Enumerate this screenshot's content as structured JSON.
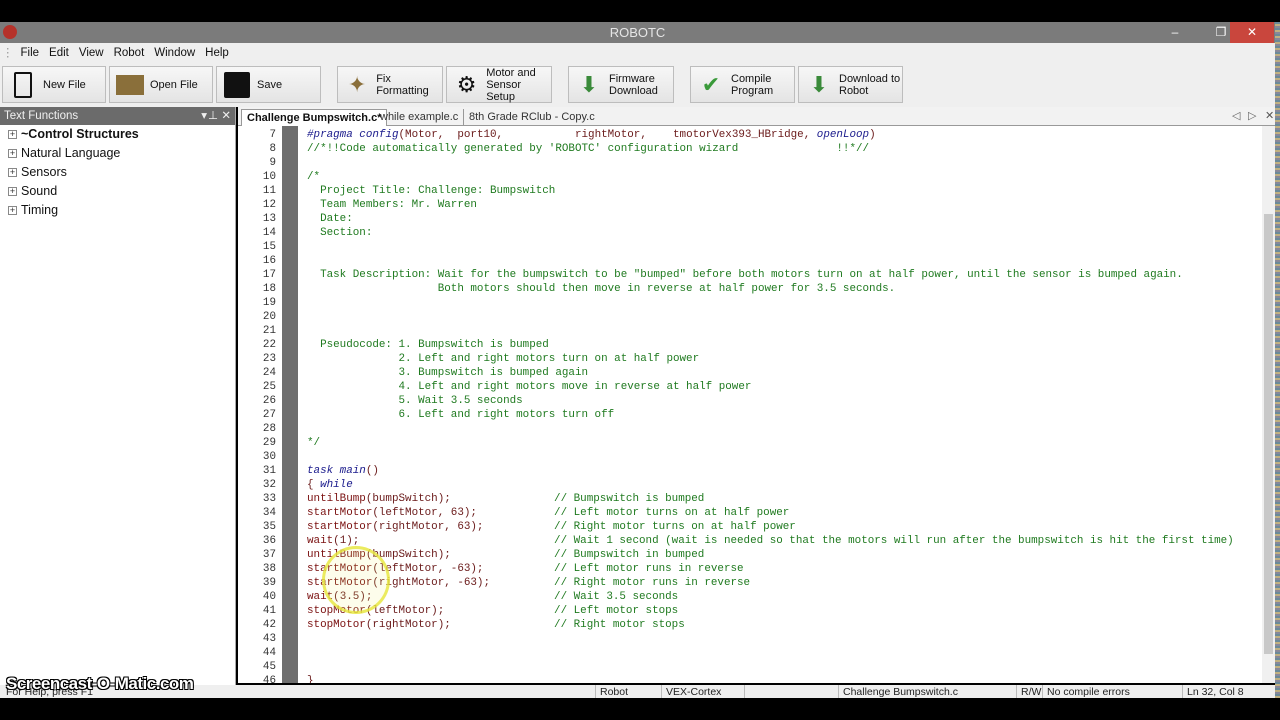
{
  "window": {
    "title": "ROBOTC",
    "minimize": "–",
    "restore": "❐",
    "close": "✕"
  },
  "menu": [
    "File",
    "Edit",
    "View",
    "Robot",
    "Window",
    "Help"
  ],
  "toolbar": {
    "new_file": "New File",
    "open_file": "Open File",
    "save": "Save",
    "fix_formatting": "Fix Formatting",
    "motor_setup_1": "Motor and",
    "motor_setup_2": "Sensor Setup",
    "firmware_1": "Firmware",
    "firmware_2": "Download",
    "compile_1": "Compile",
    "compile_2": "Program",
    "download_1": "Download to",
    "download_2": "Robot"
  },
  "left_panel": {
    "title": "Text Functions",
    "items": [
      "~Control Structures",
      "Natural Language",
      "Sensors",
      "Sound",
      "Timing"
    ]
  },
  "tabs": [
    "Challenge Bumpswitch.c*",
    "while example.c",
    "8th Grade RClub - Copy.c"
  ],
  "code": [
    {
      "n": "7",
      "t": [
        [
          "kw",
          "#pragma "
        ],
        [
          "kw",
          "config"
        ],
        [
          "pl",
          "(Motor,  port10,           rightMotor,    tmotorVex393_HBridge, "
        ],
        [
          "kw",
          "openLoop"
        ],
        [
          "pl",
          ")"
        ]
      ]
    },
    {
      "n": "8",
      "t": [
        [
          "cm",
          "//*!!Code automatically generated by 'ROBOTC' configuration wizard               !!*//"
        ]
      ]
    },
    {
      "n": "9",
      "t": []
    },
    {
      "n": "10",
      "t": [
        [
          "cm",
          "/*"
        ]
      ]
    },
    {
      "n": "11",
      "t": [
        [
          "cm",
          "  Project Title: Challenge: Bumpswitch"
        ]
      ]
    },
    {
      "n": "12",
      "t": [
        [
          "cm",
          "  Team Members: Mr. Warren"
        ]
      ]
    },
    {
      "n": "13",
      "t": [
        [
          "cm",
          "  Date:"
        ]
      ]
    },
    {
      "n": "14",
      "t": [
        [
          "cm",
          "  Section:"
        ]
      ]
    },
    {
      "n": "15",
      "t": []
    },
    {
      "n": "16",
      "t": []
    },
    {
      "n": "17",
      "t": [
        [
          "cm",
          "  Task Description: Wait for the bumpswitch to be \"bumped\" before both motors turn on at half power, until the sensor is bumped again."
        ]
      ]
    },
    {
      "n": "18",
      "t": [
        [
          "cm",
          "                    Both motors should then move in reverse at half power for 3.5 seconds."
        ]
      ]
    },
    {
      "n": "19",
      "t": []
    },
    {
      "n": "20",
      "t": []
    },
    {
      "n": "21",
      "t": []
    },
    {
      "n": "22",
      "t": [
        [
          "cm",
          "  Pseudocode: 1. Bumpswitch is bumped"
        ]
      ]
    },
    {
      "n": "23",
      "t": [
        [
          "cm",
          "              2. Left and right motors turn on at half power"
        ]
      ]
    },
    {
      "n": "24",
      "t": [
        [
          "cm",
          "              3. Bumpswitch is bumped again"
        ]
      ]
    },
    {
      "n": "25",
      "t": [
        [
          "cm",
          "              4. Left and right motors move in reverse at half power"
        ]
      ]
    },
    {
      "n": "26",
      "t": [
        [
          "cm",
          "              5. Wait 3.5 seconds"
        ]
      ]
    },
    {
      "n": "27",
      "t": [
        [
          "cm",
          "              6. Left and right motors turn off"
        ]
      ]
    },
    {
      "n": "28",
      "t": []
    },
    {
      "n": "29",
      "t": [
        [
          "cm",
          "*/"
        ]
      ]
    },
    {
      "n": "30",
      "t": []
    },
    {
      "n": "31",
      "t": [
        [
          "kw",
          "task main"
        ],
        [
          "pl",
          "()"
        ]
      ]
    },
    {
      "n": "32",
      "t": [
        [
          "pl",
          "{ "
        ],
        [
          "kw",
          "while"
        ]
      ]
    },
    {
      "n": "33",
      "t": [
        [
          "fn",
          "untilBump"
        ],
        [
          "pl",
          "(bumpSwitch);"
        ]
      ],
      "c": "// Bumpswitch is bumped"
    },
    {
      "n": "34",
      "t": [
        [
          "fn",
          "startMotor"
        ],
        [
          "pl",
          "(leftMotor, 63);"
        ]
      ],
      "c": "// Left motor turns on at half power"
    },
    {
      "n": "35",
      "t": [
        [
          "fn",
          "startMotor"
        ],
        [
          "pl",
          "(rightMotor, 63);"
        ]
      ],
      "c": "// Right motor turns on at half power"
    },
    {
      "n": "36",
      "t": [
        [
          "fn",
          "wait"
        ],
        [
          "pl",
          "(1);"
        ]
      ],
      "c": "// Wait 1 second (wait is needed so that the motors will run after the bumpswitch is hit the first time)"
    },
    {
      "n": "37",
      "t": [
        [
          "fn",
          "untilBump"
        ],
        [
          "pl",
          "(bumpSwitch);"
        ]
      ],
      "c": "// Bumpswitch in bumped"
    },
    {
      "n": "38",
      "t": [
        [
          "fn",
          "startMotor"
        ],
        [
          "pl",
          "(leftMotor, -63);"
        ]
      ],
      "c": "// Left motor runs in reverse"
    },
    {
      "n": "39",
      "t": [
        [
          "fn",
          "startMotor"
        ],
        [
          "pl",
          "(rightMotor, -63);"
        ]
      ],
      "c": "// Right motor runs in reverse"
    },
    {
      "n": "40",
      "t": [
        [
          "fn",
          "wait"
        ],
        [
          "pl",
          "(3.5);"
        ]
      ],
      "c": "// Wait 3.5 seconds"
    },
    {
      "n": "41",
      "t": [
        [
          "fn",
          "stopMotor"
        ],
        [
          "pl",
          "(leftMotor);"
        ]
      ],
      "c": "// Left motor stops"
    },
    {
      "n": "42",
      "t": [
        [
          "fn",
          "stopMotor"
        ],
        [
          "pl",
          "(rightMotor);"
        ]
      ],
      "c": "// Right motor stops"
    },
    {
      "n": "43",
      "t": []
    },
    {
      "n": "44",
      "t": []
    },
    {
      "n": "45",
      "t": []
    },
    {
      "n": "46",
      "t": [
        [
          "pl",
          "}"
        ]
      ]
    }
  ],
  "status": {
    "help": "For Help, press F1",
    "robot": "Robot",
    "platform": "VEX-Cortex",
    "file": "Challenge Bumpswitch.c",
    "mode": "R/W",
    "errors": "No compile errors",
    "position": "Ln 32, Col 8"
  },
  "watermark": "Screencast-O-Matic.com"
}
